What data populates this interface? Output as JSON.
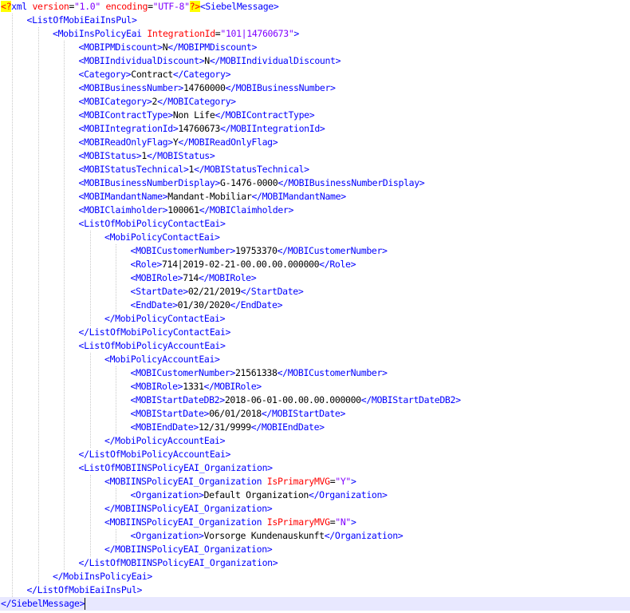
{
  "editor": {
    "lines": [
      {
        "depth": 0,
        "seg": [
          [
            "pi",
            "<?"
          ],
          [
            "tag",
            "xml "
          ],
          [
            "attr",
            "version"
          ],
          [
            "txt",
            "="
          ],
          [
            "val",
            "\"1.0\""
          ],
          [
            "attr",
            " encoding"
          ],
          [
            "txt",
            "="
          ],
          [
            "val",
            "\"UTF-8\""
          ],
          [
            "pi",
            "?>"
          ],
          [
            "tag",
            "<SiebelMessage>"
          ]
        ]
      },
      {
        "depth": 1,
        "seg": [
          [
            "tag",
            "<ListOfMobiEaiInsPul>"
          ]
        ]
      },
      {
        "depth": 2,
        "seg": [
          [
            "tag",
            "<MobiInsPolicyEai "
          ],
          [
            "attr",
            "IntegrationId"
          ],
          [
            "txt",
            "="
          ],
          [
            "val",
            "\"101|14760673\""
          ],
          [
            "tag",
            ">"
          ]
        ]
      },
      {
        "depth": 3,
        "seg": [
          [
            "tag",
            "<MOBIPMDiscount>"
          ],
          [
            "txt",
            "N"
          ],
          [
            "tag",
            "</MOBIPMDiscount>"
          ]
        ]
      },
      {
        "depth": 3,
        "seg": [
          [
            "tag",
            "<MOBIIndividualDiscount>"
          ],
          [
            "txt",
            "N"
          ],
          [
            "tag",
            "</MOBIIndividualDiscount>"
          ]
        ]
      },
      {
        "depth": 3,
        "seg": [
          [
            "tag",
            "<Category>"
          ],
          [
            "txt",
            "Contract"
          ],
          [
            "tag",
            "</Category>"
          ]
        ]
      },
      {
        "depth": 3,
        "seg": [
          [
            "tag",
            "<MOBIBusinessNumber>"
          ],
          [
            "txt",
            "14760000"
          ],
          [
            "tag",
            "</MOBIBusinessNumber>"
          ]
        ]
      },
      {
        "depth": 3,
        "seg": [
          [
            "tag",
            "<MOBICategory>"
          ],
          [
            "txt",
            "2"
          ],
          [
            "tag",
            "</MOBICategory>"
          ]
        ]
      },
      {
        "depth": 3,
        "seg": [
          [
            "tag",
            "<MOBIContractType>"
          ],
          [
            "txt",
            "Non Life"
          ],
          [
            "tag",
            "</MOBIContractType>"
          ]
        ]
      },
      {
        "depth": 3,
        "seg": [
          [
            "tag",
            "<MOBIIntegrationId>"
          ],
          [
            "txt",
            "14760673"
          ],
          [
            "tag",
            "</MOBIIntegrationId>"
          ]
        ]
      },
      {
        "depth": 3,
        "seg": [
          [
            "tag",
            "<MOBIReadOnlyFlag>"
          ],
          [
            "txt",
            "Y"
          ],
          [
            "tag",
            "</MOBIReadOnlyFlag>"
          ]
        ]
      },
      {
        "depth": 3,
        "seg": [
          [
            "tag",
            "<MOBIStatus>"
          ],
          [
            "txt",
            "1"
          ],
          [
            "tag",
            "</MOBIStatus>"
          ]
        ]
      },
      {
        "depth": 3,
        "seg": [
          [
            "tag",
            "<MOBIStatusTechnical>"
          ],
          [
            "txt",
            "1"
          ],
          [
            "tag",
            "</MOBIStatusTechnical>"
          ]
        ]
      },
      {
        "depth": 3,
        "seg": [
          [
            "tag",
            "<MOBIBusinessNumberDisplay>"
          ],
          [
            "txt",
            "G-1476-0000"
          ],
          [
            "tag",
            "</MOBIBusinessNumberDisplay>"
          ]
        ]
      },
      {
        "depth": 3,
        "seg": [
          [
            "tag",
            "<MOBIMandantName>"
          ],
          [
            "txt",
            "Mandant-Mobiliar"
          ],
          [
            "tag",
            "</MOBIMandantName>"
          ]
        ]
      },
      {
        "depth": 3,
        "seg": [
          [
            "tag",
            "<MOBIClaimholder>"
          ],
          [
            "txt",
            "100061"
          ],
          [
            "tag",
            "</MOBIClaimholder>"
          ]
        ]
      },
      {
        "depth": 3,
        "seg": [
          [
            "tag",
            "<ListOfMobiPolicyContactEai>"
          ]
        ]
      },
      {
        "depth": 4,
        "seg": [
          [
            "tag",
            "<MobiPolicyContactEai>"
          ]
        ]
      },
      {
        "depth": 5,
        "seg": [
          [
            "tag",
            "<MOBICustomerNumber>"
          ],
          [
            "txt",
            "19753370"
          ],
          [
            "tag",
            "</MOBICustomerNumber>"
          ]
        ]
      },
      {
        "depth": 5,
        "seg": [
          [
            "tag",
            "<Role>"
          ],
          [
            "txt",
            "714|2019-02-21-00.00.00.000000"
          ],
          [
            "tag",
            "</Role>"
          ]
        ]
      },
      {
        "depth": 5,
        "seg": [
          [
            "tag",
            "<MOBIRole>"
          ],
          [
            "txt",
            "714"
          ],
          [
            "tag",
            "</MOBIRole>"
          ]
        ]
      },
      {
        "depth": 5,
        "seg": [
          [
            "tag",
            "<StartDate>"
          ],
          [
            "txt",
            "02/21/2019"
          ],
          [
            "tag",
            "</StartDate>"
          ]
        ]
      },
      {
        "depth": 5,
        "seg": [
          [
            "tag",
            "<EndDate>"
          ],
          [
            "txt",
            "01/30/2020"
          ],
          [
            "tag",
            "</EndDate>"
          ]
        ]
      },
      {
        "depth": 4,
        "seg": [
          [
            "tag",
            "</MobiPolicyContactEai>"
          ]
        ]
      },
      {
        "depth": 3,
        "seg": [
          [
            "tag",
            "</ListOfMobiPolicyContactEai>"
          ]
        ]
      },
      {
        "depth": 3,
        "seg": [
          [
            "tag",
            "<ListOfMobiPolicyAccountEai>"
          ]
        ]
      },
      {
        "depth": 4,
        "seg": [
          [
            "tag",
            "<MobiPolicyAccountEai>"
          ]
        ]
      },
      {
        "depth": 5,
        "seg": [
          [
            "tag",
            "<MOBICustomerNumber>"
          ],
          [
            "txt",
            "21561338"
          ],
          [
            "tag",
            "</MOBICustomerNumber>"
          ]
        ]
      },
      {
        "depth": 5,
        "seg": [
          [
            "tag",
            "<MOBIRole>"
          ],
          [
            "txt",
            "1331"
          ],
          [
            "tag",
            "</MOBIRole>"
          ]
        ]
      },
      {
        "depth": 5,
        "seg": [
          [
            "tag",
            "<MOBIStartDateDB2>"
          ],
          [
            "txt",
            "2018-06-01-00.00.00.000000"
          ],
          [
            "tag",
            "</MOBIStartDateDB2>"
          ]
        ]
      },
      {
        "depth": 5,
        "seg": [
          [
            "tag",
            "<MOBIStartDate>"
          ],
          [
            "txt",
            "06/01/2018"
          ],
          [
            "tag",
            "</MOBIStartDate>"
          ]
        ]
      },
      {
        "depth": 5,
        "seg": [
          [
            "tag",
            "<MOBIEndDate>"
          ],
          [
            "txt",
            "12/31/9999"
          ],
          [
            "tag",
            "</MOBIEndDate>"
          ]
        ]
      },
      {
        "depth": 4,
        "seg": [
          [
            "tag",
            "</MobiPolicyAccountEai>"
          ]
        ]
      },
      {
        "depth": 3,
        "seg": [
          [
            "tag",
            "</ListOfMobiPolicyAccountEai>"
          ]
        ]
      },
      {
        "depth": 3,
        "seg": [
          [
            "tag",
            "<ListOfMOBIINSPolicyEAI_Organization>"
          ]
        ]
      },
      {
        "depth": 4,
        "seg": [
          [
            "tag",
            "<MOBIINSPolicyEAI_Organization "
          ],
          [
            "attr",
            "IsPrimaryMVG"
          ],
          [
            "txt",
            "="
          ],
          [
            "val",
            "\"Y\""
          ],
          [
            "tag",
            ">"
          ]
        ]
      },
      {
        "depth": 5,
        "seg": [
          [
            "tag",
            "<Organization>"
          ],
          [
            "txt",
            "Default Organization"
          ],
          [
            "tag",
            "</Organization>"
          ]
        ]
      },
      {
        "depth": 4,
        "seg": [
          [
            "tag",
            "</MOBIINSPolicyEAI_Organization>"
          ]
        ]
      },
      {
        "depth": 4,
        "seg": [
          [
            "tag",
            "<MOBIINSPolicyEAI_Organization "
          ],
          [
            "attr",
            "IsPrimaryMVG"
          ],
          [
            "txt",
            "="
          ],
          [
            "val",
            "\"N\""
          ],
          [
            "tag",
            ">"
          ]
        ]
      },
      {
        "depth": 5,
        "seg": [
          [
            "tag",
            "<Organization>"
          ],
          [
            "txt",
            "Vorsorge Kundenauskunft"
          ],
          [
            "tag",
            "</Organization>"
          ]
        ]
      },
      {
        "depth": 4,
        "seg": [
          [
            "tag",
            "</MOBIINSPolicyEAI_Organization>"
          ]
        ]
      },
      {
        "depth": 3,
        "seg": [
          [
            "tag",
            "</ListOfMOBIINSPolicyEAI_Organization>"
          ]
        ]
      },
      {
        "depth": 2,
        "seg": [
          [
            "tag",
            "</MobiInsPolicyEai>"
          ]
        ]
      },
      {
        "depth": 1,
        "seg": [
          [
            "tag",
            "</ListOfMobiEaiInsPul>"
          ]
        ]
      },
      {
        "depth": 0,
        "seg": [
          [
            "tag",
            "</SiebelMessage>"
          ]
        ],
        "current": true
      }
    ]
  }
}
